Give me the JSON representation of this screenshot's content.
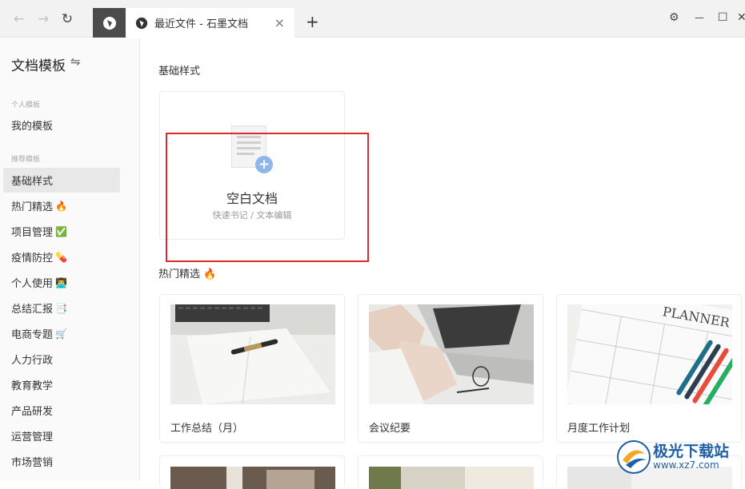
{
  "tabs": {
    "active_title": "最近文件 - 石墨文档",
    "close_glyph": "×",
    "add_glyph": "+"
  },
  "nav": {
    "back_glyph": "←",
    "forward_glyph": "→",
    "refresh_glyph": "↻"
  },
  "window": {
    "settings_glyph": "⚙",
    "minimize_glyph": "—",
    "maximize_glyph": "☐",
    "close_glyph": "✕"
  },
  "sidebar": {
    "title": "文档模板",
    "switch_glyph": "⇋",
    "group_personal": "个人模板",
    "group_recommended": "推荐模板",
    "items": [
      {
        "label": "我的模板",
        "emoji": ""
      },
      {
        "label": "基础样式",
        "emoji": ""
      },
      {
        "label": "热门精选",
        "emoji": "🔥"
      },
      {
        "label": "项目管理",
        "emoji": "✅"
      },
      {
        "label": "疫情防控",
        "emoji": "💊"
      },
      {
        "label": "个人使用",
        "emoji": "👨‍💻"
      },
      {
        "label": "总结汇报",
        "emoji": "📑"
      },
      {
        "label": "电商专题",
        "emoji": "🛒"
      },
      {
        "label": "人力行政",
        "emoji": ""
      },
      {
        "label": "教育教学",
        "emoji": ""
      },
      {
        "label": "产品研发",
        "emoji": ""
      },
      {
        "label": "运营管理",
        "emoji": ""
      },
      {
        "label": "市场营销",
        "emoji": ""
      }
    ]
  },
  "main": {
    "basic_section": "基础样式",
    "blank_doc": {
      "title": "空白文档",
      "subtitle": "快速书记 / 文本编辑",
      "plus_glyph": "+"
    },
    "hot_section": "热门精选",
    "hot_emoji": "🔥",
    "templates": [
      {
        "label": "工作总结（月）"
      },
      {
        "label": "会议纪要"
      },
      {
        "label": "月度工作计划"
      }
    ],
    "planner_text": "PLANNER"
  },
  "watermark": {
    "name": "极光下载站",
    "url": "www.xz7.com"
  },
  "colors": {
    "accent": "#e0292b",
    "plus_badge": "#8fb6ea",
    "active_sidebar": "#e8e8e8",
    "home_tab": "#4b4b4b"
  }
}
